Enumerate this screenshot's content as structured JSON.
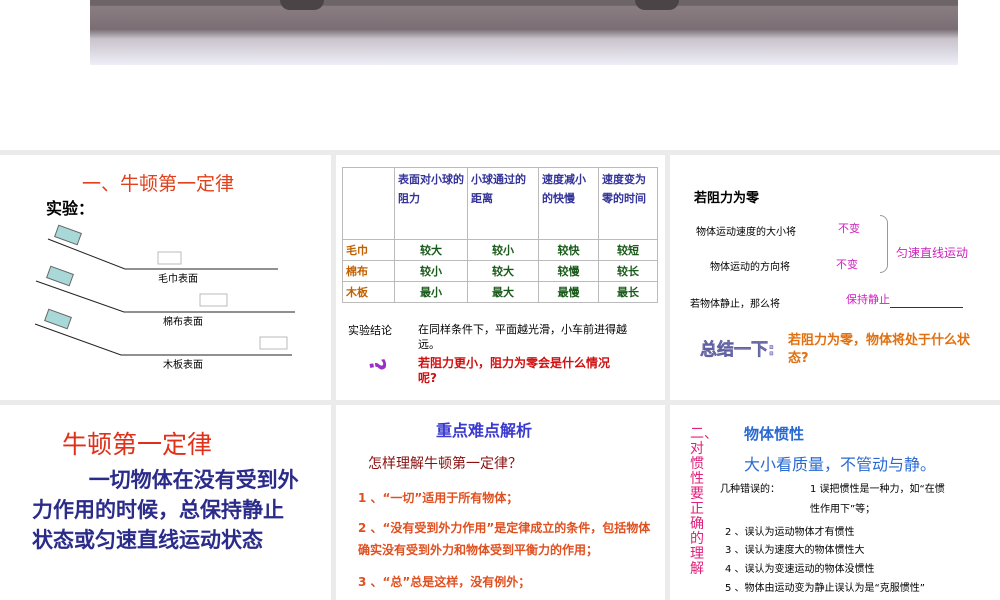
{
  "slide1": {
    "title": "一、牛顿第一定律",
    "subtitle": "实验：",
    "surfaces": [
      "毛巾表面",
      "棉布表面",
      "木板表面"
    ]
  },
  "slide2": {
    "headers": [
      "表面对小球的阻力",
      "小球通过的距离",
      "速度减小的快慢",
      "速度变为零的时间"
    ],
    "rows": [
      {
        "label": "毛巾",
        "cells": [
          "较大",
          "较小",
          "较快",
          "较短"
        ]
      },
      {
        "label": "棉布",
        "cells": [
          "较小",
          "较大",
          "较慢",
          "较长"
        ]
      },
      {
        "label": "木板",
        "cells": [
          "最小",
          "最大",
          "最慢",
          "最长"
        ]
      }
    ],
    "conclusion_label": "实验结论",
    "conclusion": "在同样条件下，平面越光滑，小车前进得越远。",
    "question": "若阻力更小，阻力为零会是什么情况呢?"
  },
  "slide3": {
    "title": "若阻力为零",
    "line1": "物体运动速度的大小将",
    "ans1": "不变",
    "line2": "物体运动的方向将",
    "ans2": "不变",
    "result": "匀速直线运动",
    "line3": "若物体静止，那么将",
    "ans3": "保持静止",
    "summary_label": "总结一下:",
    "summary": "若阻力为零，物体将处于什么状态?"
  },
  "slide4": {
    "title": "牛顿第一定律",
    "body": "一切物体在没有受到外力作用的时候，总保持静止状态或匀速直线运动状态"
  },
  "slide5": {
    "title": "重点难点解析",
    "question": "怎样理解牛顿第一定律？",
    "points": [
      "1 、“一切”适用于所有物体；",
      "2 、“没有受到外力作用”是定律成立的条件，包括物体确实没有受到外力和物体受到平衡力的作用；",
      "3 、“总”总是这样，没有例外；"
    ]
  },
  "slide6": {
    "side": "二、对惯性要正确的理解",
    "title": "物体惯性",
    "subtitle": "大小看质量，不管动与静。",
    "intro": "几种错误的：",
    "item1": "1 误把惯性是一种力，如“在惯性作用下”等；",
    "items": [
      "2 、误认为运动物体才有惯性",
      "3 、误认为速度大的物体惯性大",
      "4 、误认为变速运动的物体没惯性",
      "5 、物体由运动变为静止误认为是“克服惯性”"
    ]
  }
}
